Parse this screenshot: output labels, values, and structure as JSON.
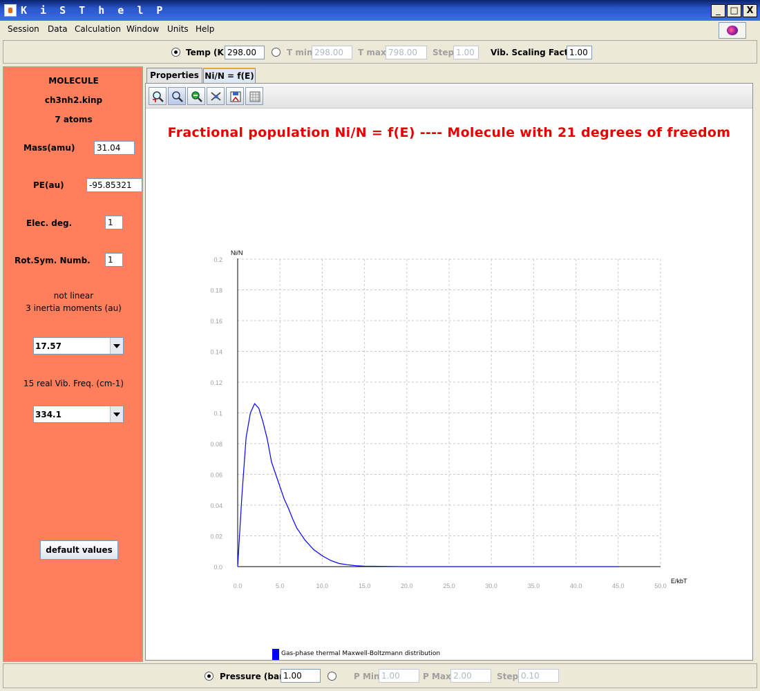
{
  "window": {
    "title": "K i S T h e l P",
    "minimize": "_",
    "maximize": "□",
    "close": "X"
  },
  "menu": [
    "Session",
    "Data",
    "Calculation",
    "Window",
    "Units",
    "Help"
  ],
  "temperature_bar": {
    "temp_label": "Temp (K)",
    "temp_value": "298.00",
    "tmin_label": "T min",
    "tmin_value": "298.00",
    "tmax_label": "T max",
    "tmax_value": "798.00",
    "step_label": "Step",
    "step_value": "1.00",
    "vib_label": "Vib. Scaling Factor",
    "vib_value": "1.00"
  },
  "pressure_bar": {
    "pressure_label": "Pressure (bar)",
    "pressure_value": "1.00",
    "pmin_label": "P Min",
    "pmin_value": "1.00",
    "pmax_label": "P Max",
    "pmax_value": "2.00",
    "step_label": "Step",
    "step_value": "0.10"
  },
  "left_panel": {
    "heading": "MOLECULE",
    "file": "ch3nh2.kinp",
    "atoms": "7 atoms",
    "mass_label": "Mass(amu)",
    "mass_value": "31.04",
    "pe_label": "PE(au)",
    "pe_value": "-95.85321",
    "elec_label": "Elec. deg.",
    "elec_value": "1",
    "rot_label": "Rot.Sym. Numb.",
    "rot_value": "1",
    "linear_text": "not linear",
    "inertia_text": "3 inertia moments (au)",
    "inertia_selected": "17.57",
    "freq_text": "15 real Vib. Freq. (cm-1)",
    "freq_selected": "334.1",
    "default_button": "default values"
  },
  "tabs": [
    "Properties",
    "Ni/N = f(E)"
  ],
  "chart_toolbar_icons": [
    "zoom-reset-icon",
    "zoom-icon",
    "zoom-out-icon",
    "settings-icon",
    "save-icon",
    "grid-icon"
  ],
  "chart_data": {
    "type": "line",
    "title": "Fractional population Ni/N = f(E) ---- Molecule with 21 degrees of freedom",
    "xlabel": "E/kbT",
    "ylabel": "Ni/N",
    "xlim": [
      0,
      50
    ],
    "ylim": [
      0,
      0.2
    ],
    "x_ticks": [
      "0.0",
      "5.0",
      "10.0",
      "15.0",
      "20.0",
      "25.0",
      "30.0",
      "35.0",
      "40.0",
      "45.0",
      "50.0"
    ],
    "y_ticks": [
      "0.0",
      "0.02",
      "0.04",
      "0.06",
      "0.08",
      "0.1",
      "0.12",
      "0.14",
      "0.16",
      "0.18",
      "0.2"
    ],
    "grid": true,
    "series": [
      {
        "name": "Gas-phase thermal Maxwell-Boltzmann distribution",
        "color": "#0000ff",
        "x": [
          0,
          0.5,
          1.0,
          1.5,
          2.0,
          2.5,
          3.0,
          3.5,
          4.0,
          4.5,
          5.0,
          5.5,
          6.0,
          6.5,
          7.0,
          7.5,
          8.0,
          8.5,
          9.0,
          10.0,
          11.0,
          12.0,
          13.0,
          14.0,
          15.0,
          20.0,
          25.0,
          30.0,
          35.0,
          40.0,
          45.0
        ],
        "y": [
          0,
          0.046,
          0.084,
          0.1,
          0.106,
          0.103,
          0.094,
          0.083,
          0.068,
          0.06,
          0.052,
          0.044,
          0.038,
          0.031,
          0.025,
          0.021,
          0.017,
          0.014,
          0.011,
          0.007,
          0.004,
          0.002,
          0.0012,
          0.0006,
          0.0003,
          0.0,
          0.0,
          0.0,
          0.0,
          0.0,
          0.0
        ]
      }
    ]
  }
}
